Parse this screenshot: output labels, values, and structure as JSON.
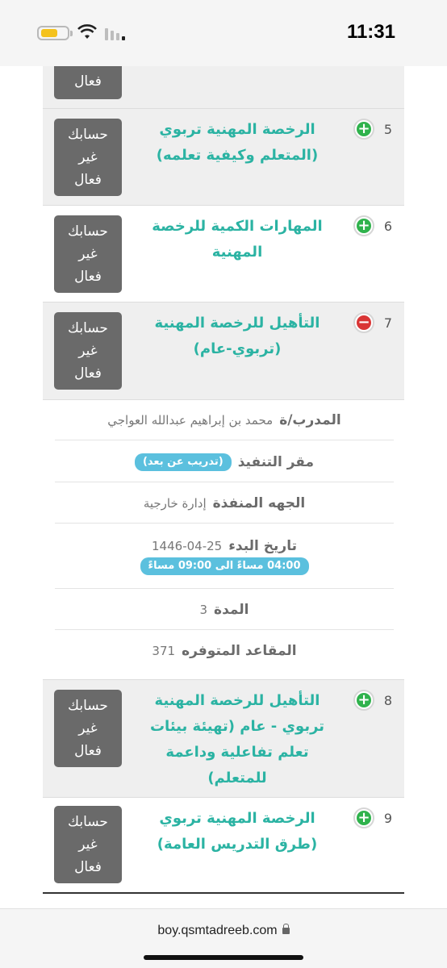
{
  "status_bar": {
    "time": "11:31"
  },
  "top_partial": {
    "button_label": "فعال"
  },
  "courses": [
    {
      "number": "5",
      "expand": "plus",
      "title": "الرخصة المهنية تربوي (المتعلم وكيفية تعلمه)",
      "status_lines": [
        "حسابك",
        "غير",
        "فعال"
      ]
    },
    {
      "number": "6",
      "expand": "plus",
      "title": "المهارات الكمية للرخصة المهنية",
      "status_lines": [
        "حسابك",
        "غير",
        "فعال"
      ]
    },
    {
      "number": "7",
      "expand": "minus",
      "title": "التأهيل للرخصة المهنية (تربوي-عام)",
      "status_lines": [
        "حسابك",
        "غير",
        "فعال"
      ]
    },
    {
      "number": "8",
      "expand": "plus",
      "title": "التأهيل للرخصة المهنية تربوي - عام (تهيئة بيئات تعلم تفاعلية وداعمة للمتعلم)",
      "status_lines": [
        "حسابك",
        "غير",
        "فعال"
      ]
    },
    {
      "number": "9",
      "expand": "plus",
      "title": "الرخصة المهنية تربوي (طرق التدريس العامة)",
      "status_lines": [
        "حسابك",
        "غير",
        "فعال"
      ]
    }
  ],
  "details": {
    "trainer_label": "المدرب/ة",
    "trainer_value": "محمد بن إبراهيم عبدالله العواجي",
    "venue_label": "مقر التنفيذ",
    "venue_value": "(تدريب عن بعد)",
    "entity_label": "الجهه المنفذة",
    "entity_value": "إدارة خارجية",
    "start_label": "تاريخ البدء",
    "start_value": "1446-04-25",
    "time_value": "04:00 مساءً الى 09:00 مساءً",
    "duration_label": "المدة",
    "duration_value": "3",
    "seats_label": "المقاعد المتوفره",
    "seats_value": "371"
  },
  "browser": {
    "url": "boy.qsmtadreeb.com"
  },
  "colors": {
    "title_teal": "#2bb3a3",
    "button_gray": "#6a6a6a",
    "pill_blue": "#5bc0de",
    "plus_green": "#2fb24c",
    "minus_red": "#d93535"
  }
}
